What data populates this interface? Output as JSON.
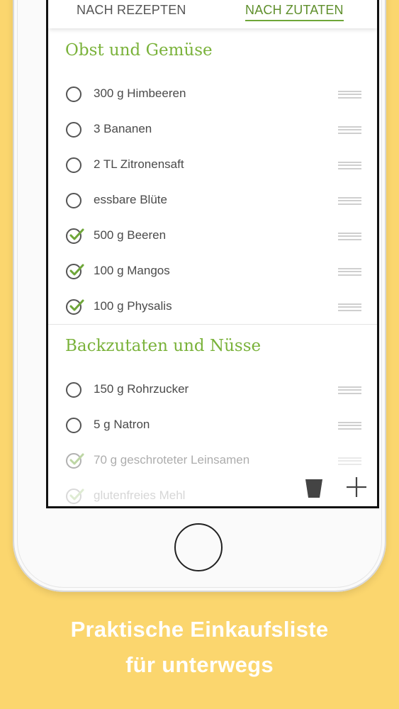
{
  "tabs": {
    "by_recipes": "NACH REZEPTEN",
    "by_ingredients": "NACH ZUTATEN",
    "active": "by_ingredients"
  },
  "sections": [
    {
      "title": "Obst und Gemüse",
      "items": [
        {
          "label": "300 g Himbeeren",
          "checked": false
        },
        {
          "label": "3 Bananen",
          "checked": false
        },
        {
          "label": "2 TL Zitronensaft",
          "checked": false
        },
        {
          "label": "essbare Blüte",
          "checked": false
        },
        {
          "label": "500 g Beeren",
          "checked": true
        },
        {
          "label": "100 g Mangos",
          "checked": true
        },
        {
          "label": "100 g Physalis",
          "checked": true
        }
      ]
    },
    {
      "title": "Backzutaten und Nüsse",
      "items": [
        {
          "label": "150 g Rohrzucker",
          "checked": false
        },
        {
          "label": "5 g Natron",
          "checked": false
        },
        {
          "label": "70 g geschroteter Leinsamen",
          "checked": true
        },
        {
          "label": "glutenfreies Mehl",
          "checked": true
        }
      ]
    }
  ],
  "toolbar": {
    "delete_icon": "trash-icon",
    "add_icon": "plus-icon"
  },
  "caption": {
    "line1": "Praktische Einkaufsliste",
    "line2": "für unterwegs"
  },
  "colors": {
    "background": "#fbd66e",
    "accent_green": "#7ab23a",
    "check_green": "#6ea638"
  }
}
